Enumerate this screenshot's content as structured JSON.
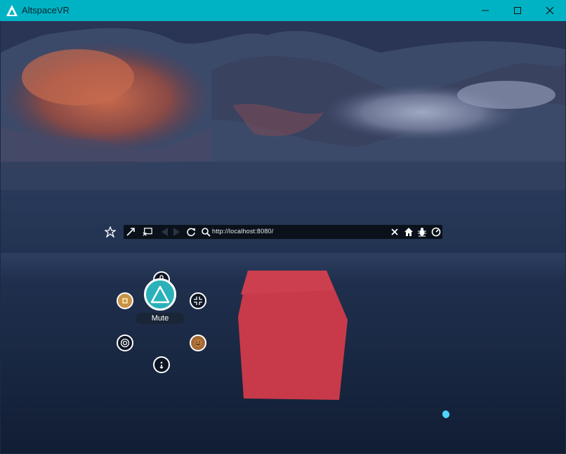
{
  "window": {
    "title": "AltspaceVR",
    "minimize_label": "minimize",
    "maximize_label": "maximize",
    "close_label": "close"
  },
  "browser": {
    "url": "http://localhost:8080/"
  },
  "radial_menu": {
    "mute_label": "Mute"
  },
  "colors": {
    "titlebar": "#00b3c4",
    "accent": "#2ab1ba",
    "cube": "#c83a4a",
    "avatar": "#c9924a"
  },
  "icons": [
    "altspace-logo-icon",
    "minimize-icon",
    "maximize-icon",
    "close-icon",
    "pin-icon",
    "collapse-icon",
    "cast-icon",
    "back-icon",
    "forward-icon",
    "reload-icon",
    "search-icon",
    "clear-icon",
    "home-icon",
    "bug-icon",
    "gauge-icon",
    "microphone-icon",
    "settings-avatar-icon",
    "compress-icon",
    "altspace-icon",
    "location-icon",
    "emoji-avatar-icon",
    "teleport-icon"
  ]
}
